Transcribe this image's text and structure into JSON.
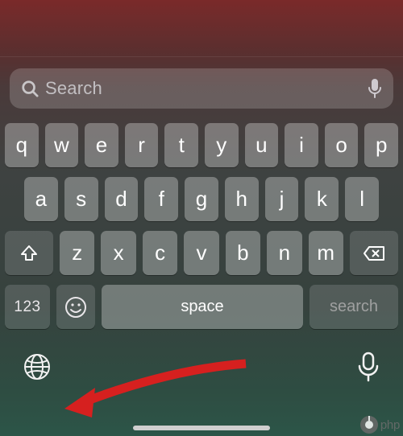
{
  "search": {
    "placeholder": "Search"
  },
  "rows": {
    "top": [
      "q",
      "w",
      "e",
      "r",
      "t",
      "y",
      "u",
      "i",
      "o",
      "p"
    ],
    "middle": [
      "a",
      "s",
      "d",
      "f",
      "g",
      "h",
      "j",
      "k",
      "l"
    ],
    "bottom": [
      "z",
      "x",
      "c",
      "v",
      "b",
      "n",
      "m"
    ]
  },
  "fn": {
    "numbers": "123",
    "space": "space",
    "search": "search"
  },
  "watermark": "php"
}
